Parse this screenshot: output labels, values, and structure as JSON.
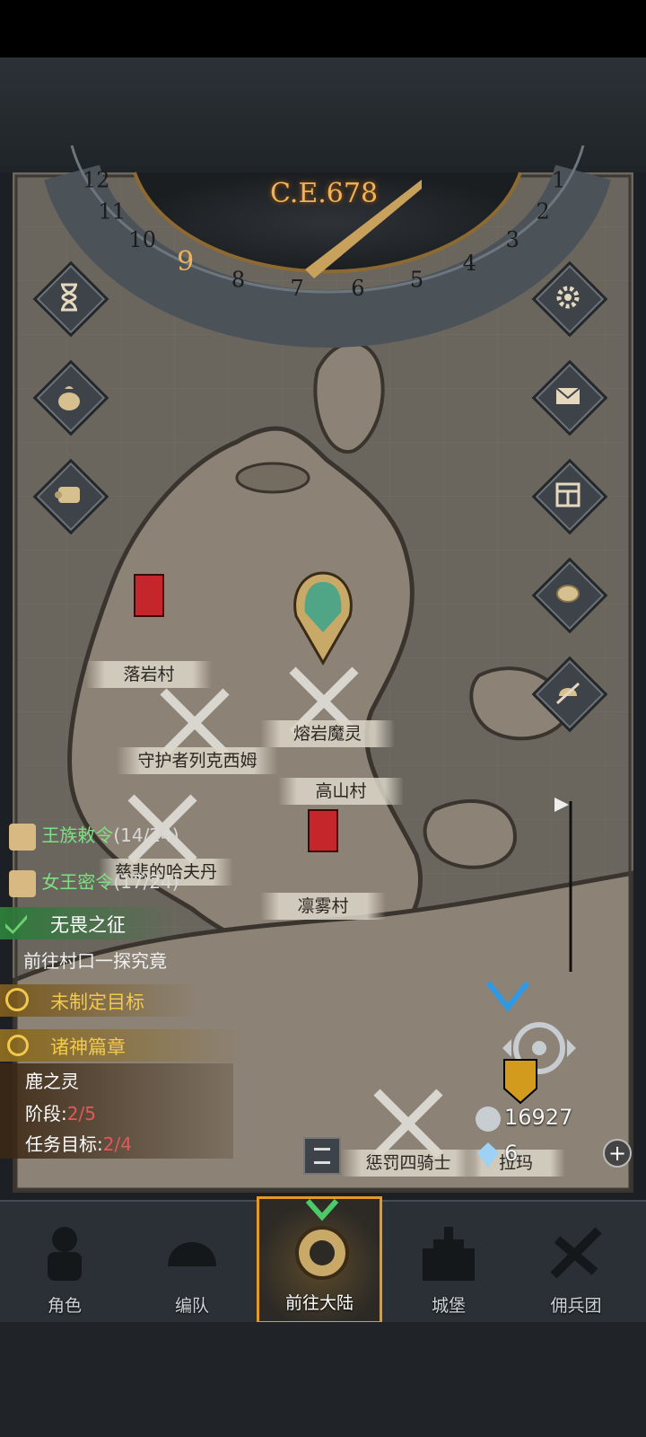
{
  "calendar": {
    "era_label": "C.E.678",
    "months": [
      "1",
      "2",
      "3",
      "4",
      "5",
      "6",
      "7",
      "8",
      "9",
      "10",
      "11",
      "12"
    ],
    "current_month": "9"
  },
  "map": {
    "locations": [
      {
        "name": "落岩村"
      },
      {
        "name": "守护者列克西姆"
      },
      {
        "name": "熔岩魔灵"
      },
      {
        "name": "高山村"
      },
      {
        "name": "凛雾村"
      },
      {
        "name": "慈悲的哈夫丹"
      },
      {
        "name": "惩罚四骑士"
      },
      {
        "name": "拉玛"
      }
    ]
  },
  "quests": {
    "royal_order": {
      "title": "王族敕令",
      "progress": "(14/24)"
    },
    "queen_order": {
      "title": "女王密令",
      "progress": "(17/24)"
    },
    "main_quest": {
      "title": "无畏之征",
      "desc": "前往村口一探究竟"
    },
    "unset_goal": {
      "title": "未制定目标"
    },
    "gods_chapter": {
      "title": "诸神篇章",
      "subtitle": "鹿之灵",
      "stage_label": "阶段:",
      "stage_value": "2/5",
      "target_label": "任务目标:",
      "target_value": "2/4"
    }
  },
  "resources": {
    "silver": "16927",
    "crystal": "6",
    "add_symbol": "+"
  },
  "bottom_nav": {
    "items": [
      {
        "label": "角色"
      },
      {
        "label": "编队"
      },
      {
        "label": "前往大陆"
      },
      {
        "label": "城堡"
      },
      {
        "label": "佣兵团"
      }
    ],
    "active_index": 2
  },
  "icons": {
    "left": [
      "hourglass-icon",
      "money-bag-icon",
      "scroll-icon"
    ],
    "right": [
      "gear-icon",
      "mail-icon",
      "grid-panel-icon",
      "coin-icon",
      "helmet-sword-icon"
    ]
  },
  "colors": {
    "accent": "#f0b35a",
    "quest_green": "#7ee084",
    "quest_yellow": "#f2c94c",
    "stage_red": "#e0595b"
  }
}
